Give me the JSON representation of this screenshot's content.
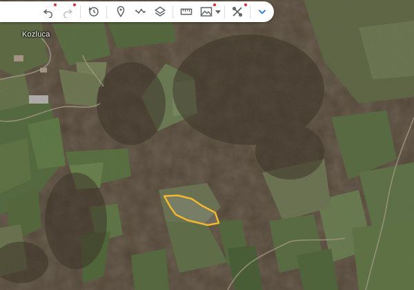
{
  "map": {
    "place_label": "Kozluca",
    "outline_color": "#f5b82e"
  },
  "toolbar": {
    "buttons": [
      {
        "name": "search-box",
        "icon": "blank-white-pill"
      },
      {
        "name": "undo-button",
        "icon": "undo-icon",
        "badge": true
      },
      {
        "name": "redo-button",
        "icon": "redo-icon",
        "badge": true
      },
      {
        "name": "history-button",
        "icon": "history-icon"
      },
      {
        "name": "add-placemark-button",
        "icon": "placemark-icon"
      },
      {
        "name": "add-path-button",
        "icon": "path-icon"
      },
      {
        "name": "layers-button",
        "icon": "layers-icon"
      },
      {
        "name": "measure-button",
        "icon": "ruler-icon"
      },
      {
        "name": "imagery-button",
        "icon": "landscape-icon",
        "badge": true,
        "dropdown": true
      },
      {
        "name": "tools-button",
        "icon": "tools-icon",
        "badge": true
      },
      {
        "name": "collapse-button",
        "icon": "chevron-down-icon"
      }
    ],
    "accent_color": "#1a73e8",
    "badge_color": "#d93025",
    "icon_color": "#5f6368"
  }
}
